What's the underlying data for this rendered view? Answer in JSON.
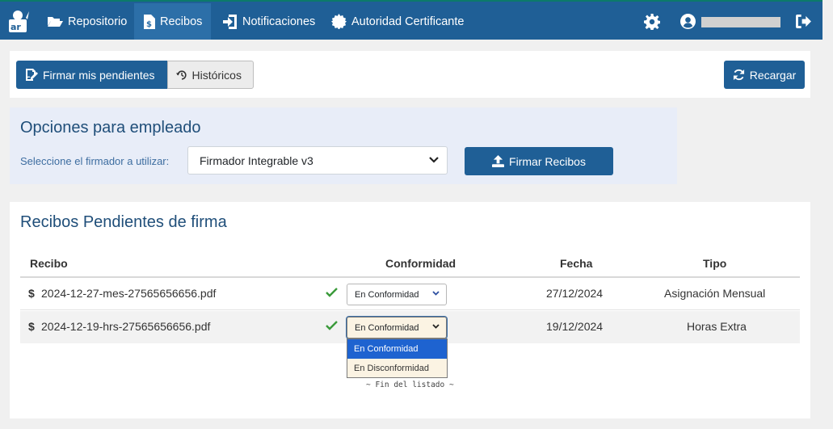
{
  "nav": {
    "items": [
      {
        "label": "Repositorio",
        "icon": "folder-open-icon"
      },
      {
        "label": "Recibos",
        "icon": "file-invoice-dollar-icon",
        "active": true
      },
      {
        "label": "Notificaciones",
        "icon": "sign-in-icon"
      },
      {
        "label": "Autoridad Certificante",
        "icon": "certificate-icon"
      }
    ]
  },
  "top": {
    "firmar_pendientes": "Firmar mis pendientes",
    "historicos": "Históricos",
    "recargar": "Recargar"
  },
  "options": {
    "title": "Opciones para empleado",
    "firmador_label": "Seleccione el firmador a utilizar:",
    "firmador_value": "Firmador Integrable v3",
    "firmar_button": "Firmar Recibos"
  },
  "recibos": {
    "title": "Recibos Pendientes de firma",
    "columns": [
      "Recibo",
      "Conformidad",
      "Fecha",
      "Tipo"
    ],
    "rows": [
      {
        "icon": "$",
        "recibo": "2024-12-27-mes-27565656656.pdf",
        "conformidad": "En Conformidad",
        "fecha": "27/12/2024",
        "tipo": "Asignación Mensual"
      },
      {
        "icon": "$",
        "recibo": "2024-12-19-hrs-27565656656.pdf",
        "conformidad": "En Conformidad",
        "fecha": "19/12/2024",
        "tipo": "Horas Extra"
      }
    ],
    "dropdown_options": [
      "En Conformidad",
      "En Disconformidad"
    ],
    "fin_listado": "~ Fin del listado ~"
  },
  "colors": {
    "navbar": "#1f5f96",
    "accent": "#1f5f96",
    "check": "#3a9a3a",
    "panel_title": "#1f4e79"
  }
}
